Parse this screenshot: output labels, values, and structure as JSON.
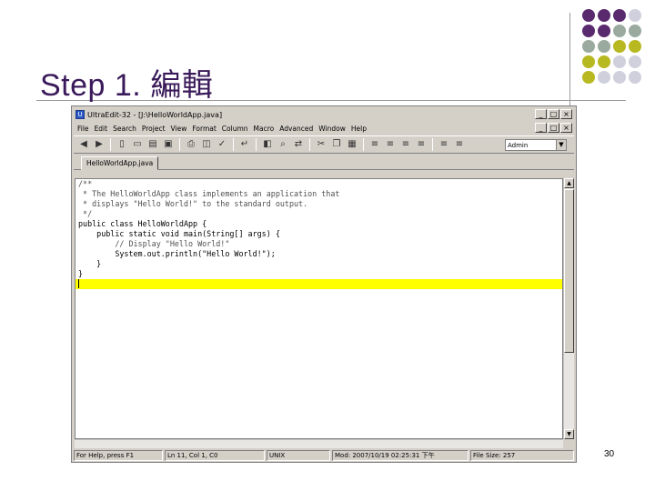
{
  "slide": {
    "title": "Step 1. 編輯",
    "page_number": "30",
    "dot_colors": [
      "#5a2a6e",
      "#9aaa9e",
      "#b8b820",
      "#cfd0dc"
    ]
  },
  "window": {
    "title": "UltraEdit-32 - [J:\\HelloWorldApp.java]",
    "controls": [
      "_",
      "□",
      "×"
    ]
  },
  "menu": {
    "items": [
      "File",
      "Edit",
      "Search",
      "Project",
      "View",
      "Format",
      "Column",
      "Macro",
      "Advanced",
      "Window",
      "Help"
    ]
  },
  "toolbar": {
    "icons": [
      "back-icon",
      "forward-icon",
      "new-file-icon",
      "open-icon",
      "open-folder-icon",
      "save-icon",
      "print-icon",
      "print-preview-icon",
      "spell-icon",
      "word-wrap-icon",
      "hex-icon",
      "find-icon",
      "replace-icon",
      "cut-icon",
      "copy-icon",
      "paste-icon",
      "align-left-icon",
      "align-center-icon",
      "align-right-icon",
      "justify-icon",
      "indent-icon",
      "outdent-icon"
    ],
    "combo_value": "Admin"
  },
  "tabs": {
    "active": "HelloWorldApp.java"
  },
  "editor": {
    "lines": [
      {
        "text": "/**",
        "kind": "comment"
      },
      {
        "text": " * The HelloWorldApp class implements an application that",
        "kind": "comment"
      },
      {
        "text": " * displays \"Hello World!\" to the standard output.",
        "kind": "comment"
      },
      {
        "text": " */",
        "kind": "comment"
      },
      {
        "text": "public class HelloWorldApp {",
        "kind": "code"
      },
      {
        "text": "    public static void main(String[] args) {",
        "kind": "code"
      },
      {
        "text": "        // Display \"Hello World!\"",
        "kind": "comment"
      },
      {
        "text": "        System.out.println(\"Hello World!\");",
        "kind": "code"
      },
      {
        "text": "    }",
        "kind": "code"
      },
      {
        "text": "}",
        "kind": "code"
      },
      {
        "text": "",
        "kind": "current"
      }
    ]
  },
  "status": {
    "help": "For Help, press F1",
    "position": "Ln 11, Col 1, C0",
    "format": "UNIX",
    "modified": "Mod: 2007/10/19 02:25:31 下午",
    "file_size": "File Size: 257"
  }
}
